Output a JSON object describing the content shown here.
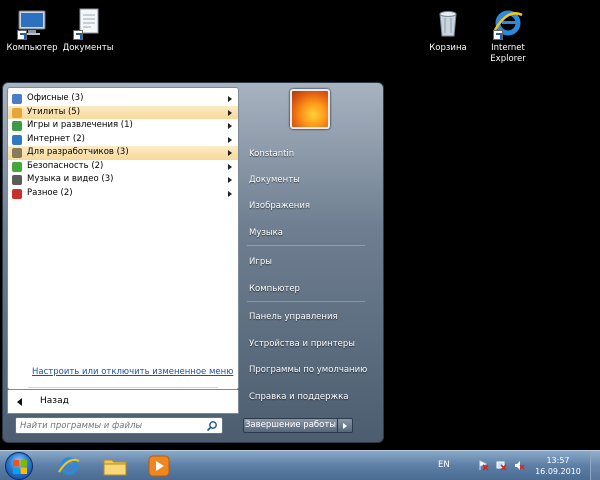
{
  "desktop": {
    "icons": [
      {
        "name": "computer",
        "label": "Компьютер"
      },
      {
        "name": "documents",
        "label": "Документы"
      },
      {
        "name": "recycle-bin",
        "label": "Корзина"
      },
      {
        "name": "internet-explorer",
        "label": "Internet Explorer"
      }
    ]
  },
  "start_menu": {
    "programs": [
      {
        "label": "Офисные (3)",
        "icon": "office-icon",
        "color": "#4a7cc8",
        "highlighted": false
      },
      {
        "label": "Утилиты (5)",
        "icon": "utilities-icon",
        "color": "#e8a63a",
        "highlighted": true
      },
      {
        "label": "Игры и развлечения (1)",
        "icon": "games-icon",
        "color": "#3d9b46",
        "highlighted": false
      },
      {
        "label": "Интернет (2)",
        "icon": "internet-icon",
        "color": "#2f78c4",
        "highlighted": false
      },
      {
        "label": "Для разработчиков (3)",
        "icon": "developer-icon",
        "color": "#8a7a5a",
        "highlighted": true
      },
      {
        "label": "Безопасность (2)",
        "icon": "security-icon",
        "color": "#46a83a",
        "highlighted": false
      },
      {
        "label": "Музыка и видео (3)",
        "icon": "media-icon",
        "color": "#5a5a5a",
        "highlighted": false
      },
      {
        "label": "Разное (2)",
        "icon": "misc-icon",
        "color": "#c8302c",
        "highlighted": false
      }
    ],
    "customize_link": "Настроить или отключить измененное меню",
    "back_label": "Назад",
    "search_placeholder": "Найти программы и файлы",
    "right_items": [
      {
        "label": "Konstantin",
        "name": "user-name"
      },
      {
        "label": "Документы",
        "name": "documents"
      },
      {
        "label": "Изображения",
        "name": "pictures"
      },
      {
        "label": "Музыка",
        "name": "music"
      },
      {
        "label": "Игры",
        "name": "games"
      },
      {
        "label": "Компьютер",
        "name": "computer"
      },
      {
        "label": "Панель управления",
        "name": "control-panel"
      },
      {
        "label": "Устройства и принтеры",
        "name": "devices-printers"
      },
      {
        "label": "Программы по умолчанию",
        "name": "default-programs"
      },
      {
        "label": "Справка и поддержка",
        "name": "help-support"
      }
    ],
    "shutdown_label": "Завершение работы"
  },
  "taskbar": {
    "language": "EN",
    "clock_time": "13:57",
    "clock_date": "16.09.2010"
  }
}
